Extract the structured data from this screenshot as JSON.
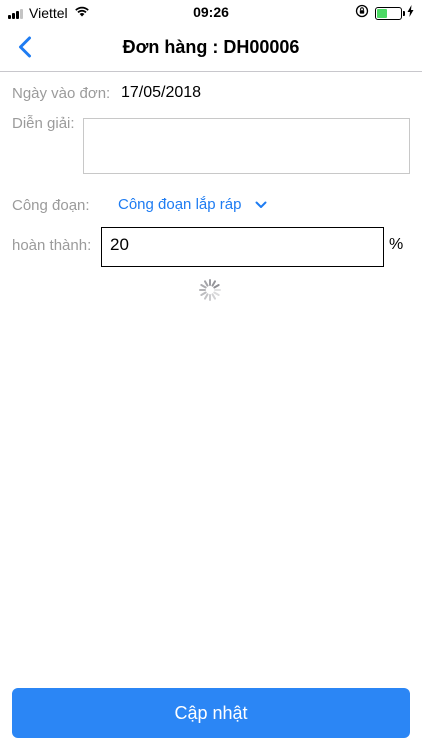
{
  "status_bar": {
    "carrier": "Viettel",
    "time": "09:26",
    "signal_bars_active": 3,
    "signal_bars_total": 4,
    "battery_level": 0.45,
    "battery_color": "#4cd964"
  },
  "nav": {
    "title": "Đơn hàng : DH00006",
    "back_icon": "chevron-left-icon"
  },
  "form": {
    "date_label": "Ngày vào đơn:",
    "date_value": "17/05/2018",
    "description_label": "Diễn giải:",
    "description_value": "",
    "stage_label": "Công đoạn:",
    "stage_value": "Công đoạn lắp ráp",
    "stage_icon": "chevron-down-icon",
    "completion_label": "hoàn thành:",
    "completion_value": "20",
    "percent_sign": "%",
    "loading_icon": "spinner-icon"
  },
  "actions": {
    "update_label": "Cập nhật"
  },
  "colors": {
    "accent": "#1e7cf2",
    "button": "#2b86f5",
    "label": "#9b9b9b"
  }
}
